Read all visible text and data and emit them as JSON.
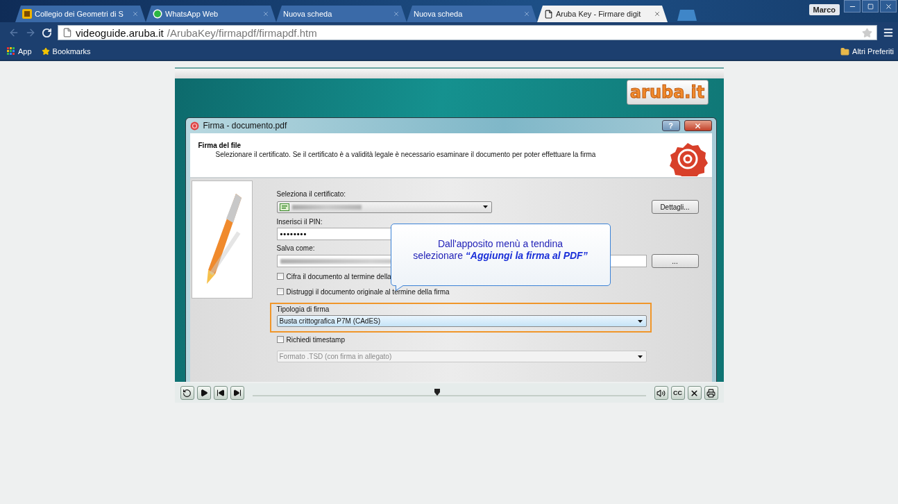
{
  "browser": {
    "tabs": [
      {
        "kind": "site",
        "title": "Collegio dei Geometri di S",
        "selected": false
      },
      {
        "kind": "whatsapp",
        "title": "WhatsApp Web",
        "selected": false
      },
      {
        "kind": "blank",
        "title": "Nuova scheda",
        "selected": false
      },
      {
        "kind": "blank",
        "title": "Nuova scheda",
        "selected": false
      },
      {
        "kind": "page",
        "title": "Aruba Key - Firmare digit",
        "selected": true
      }
    ],
    "user": "Marco",
    "address": {
      "host": "videoguide.aruba.it",
      "path": "/ArubaKey/firmapdf/firmapdf.htm"
    },
    "bookmarks": [
      {
        "kind": "apps",
        "label": "App"
      },
      {
        "kind": "star",
        "label": "Bookmarks"
      }
    ],
    "other_bookmarks": "Altri Preferiti"
  },
  "video": {
    "logo": "aruba.it",
    "dialog": {
      "title": "Firma - documento.pdf",
      "help": "?",
      "heading": "Firma del file",
      "description": "Selezionare il certificato. Se il certificato è a validità legale è necessario esaminare il documento per poter effettuare la firma",
      "fields": [
        {
          "kind": "certificate",
          "label": "Seleziona il certificato:",
          "button": "Dettagli..."
        },
        {
          "kind": "password",
          "label": "Inserisci il PIN:",
          "value": "••••••••"
        },
        {
          "kind": "path",
          "label": "Salva come:",
          "button": "..."
        },
        {
          "kind": "checkbox",
          "label": "Cifra il documento al termine della",
          "checked": false
        },
        {
          "kind": "checkbox",
          "label": "Distruggi il documento originale al termine della firma",
          "checked": false
        },
        {
          "kind": "select",
          "label": "Tipologia di firma",
          "value": "Busta crittografica P7M (CAdES)",
          "highlighted": true,
          "disabled": false
        },
        {
          "kind": "checkbox",
          "label": "Richiedi timestamp",
          "checked": false
        },
        {
          "kind": "select",
          "value": "Formato .TSD (con firma in allegato)",
          "highlighted": false,
          "disabled": true
        }
      ]
    },
    "callout": [
      "Dall'apposito menù a tendina",
      "selezionare **“Aggiungi la firma al PDF”**"
    ]
  },
  "player": {
    "buttons": [
      {
        "kind": "replay"
      },
      {
        "kind": "play"
      },
      {
        "kind": "previous"
      },
      {
        "kind": "next"
      }
    ],
    "level": 0.47,
    "right_buttons": [
      {
        "kind": "volume"
      },
      {
        "kind": "captions",
        "label": "CC"
      },
      {
        "kind": "close"
      },
      {
        "kind": "print"
      }
    ]
  }
}
